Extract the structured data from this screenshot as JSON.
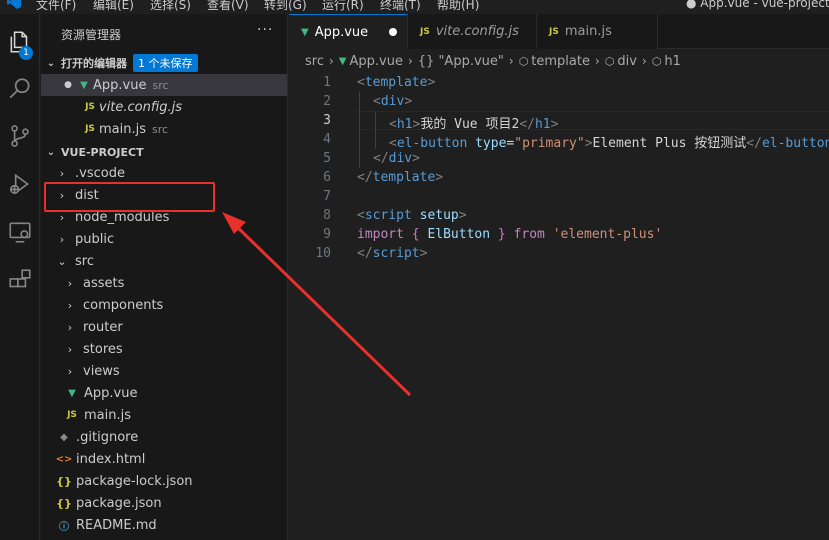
{
  "menubar": {
    "items": [
      "文件(F)",
      "编辑(E)",
      "选择(S)",
      "查看(V)",
      "转到(G)",
      "运行(R)",
      "终端(T)",
      "帮助(H)"
    ],
    "window_title": "● App.vue - vue-project - Vi"
  },
  "activity_bar": {
    "items": [
      "explorer-icon",
      "search-icon",
      "source-control-icon",
      "run-debug-icon",
      "remote-explorer-icon",
      "extensions-icon"
    ],
    "explorer_badge": "1"
  },
  "sidebar": {
    "title": "资源管理器",
    "more": "···",
    "open_editors": {
      "label": "打开的编辑器",
      "badge": "1 个未保存",
      "items": [
        {
          "name": "App.vue",
          "desc": "src",
          "icon": "vue-file-icon",
          "modified": true
        },
        {
          "name": "vite.config.js",
          "desc": "",
          "icon": "js-file-icon",
          "italic": true
        },
        {
          "name": "main.js",
          "desc": "src",
          "icon": "js-file-icon"
        }
      ]
    },
    "project": {
      "label": "VUE-PROJECT",
      "items": [
        {
          "name": ".vscode",
          "type": "folder"
        },
        {
          "name": "dist",
          "type": "folder"
        },
        {
          "name": "node_modules",
          "type": "folder"
        },
        {
          "name": "public",
          "type": "folder"
        },
        {
          "name": "src",
          "type": "folder-open"
        },
        {
          "name": "assets",
          "type": "folder"
        },
        {
          "name": "components",
          "type": "folder"
        },
        {
          "name": "router",
          "type": "folder"
        },
        {
          "name": "stores",
          "type": "folder"
        },
        {
          "name": "views",
          "type": "folder"
        },
        {
          "name": "App.vue",
          "type": "vue"
        },
        {
          "name": "main.js",
          "type": "js"
        },
        {
          "name": ".gitignore",
          "type": "git"
        },
        {
          "name": "index.html",
          "type": "html"
        },
        {
          "name": "package-lock.json",
          "type": "json"
        },
        {
          "name": "package.json",
          "type": "json"
        },
        {
          "name": "README.md",
          "type": "info"
        }
      ]
    }
  },
  "editor": {
    "tabs": [
      {
        "label": "App.vue",
        "icon": "vue-file-icon",
        "active": true,
        "modified": true
      },
      {
        "label": "vite.config.js",
        "icon": "js-file-icon",
        "italic": true
      },
      {
        "label": "main.js",
        "icon": "js-file-icon"
      }
    ],
    "breadcrumb": [
      "src",
      "App.vue",
      "{} \"App.vue\"",
      "template",
      "div",
      "h1"
    ],
    "current_line": 3,
    "line_numbers": [
      "1",
      "2",
      "3",
      "4",
      "5",
      "6",
      "7",
      "8",
      "9",
      "10"
    ],
    "code": {
      "l1_open": "<",
      "l1_tag": "template",
      "l1_close": ">",
      "l2_open": "<",
      "l2_tag": "div",
      "l2_close": ">",
      "l3_open": "<",
      "l3_tag": "h1",
      "l3_close": ">",
      "l3_text": "我的 Vue 项目2",
      "l3_end_open": "</",
      "l3_end_tag": "h1",
      "l3_end_close": ">",
      "l4_open": "<",
      "l4_tag": "el-button",
      "l4_attr": " type",
      "l4_eq": "=",
      "l4_val": "\"primary\"",
      "l4_close": ">",
      "l4_text": "Element Plus 按钮测试",
      "l4_end_open": "</",
      "l4_end_tag": "el-button",
      "l5_open": "</",
      "l5_tag": "div",
      "l5_close": ">",
      "l6_open": "</",
      "l6_tag": "template",
      "l6_close": ">",
      "l8_open": "<",
      "l8_tag": "script",
      "l8_attr": " setup",
      "l8_close": ">",
      "l9_kw": "import",
      "l9_lb": " { ",
      "l9_id": "ElButton",
      "l9_rb": " } ",
      "l9_from": "from",
      "l9_str": " 'element-plus'",
      "l10_open": "</",
      "l10_tag": "script",
      "l10_close": ">"
    }
  },
  "annotation": {
    "highlight_color": "#e8302c"
  }
}
